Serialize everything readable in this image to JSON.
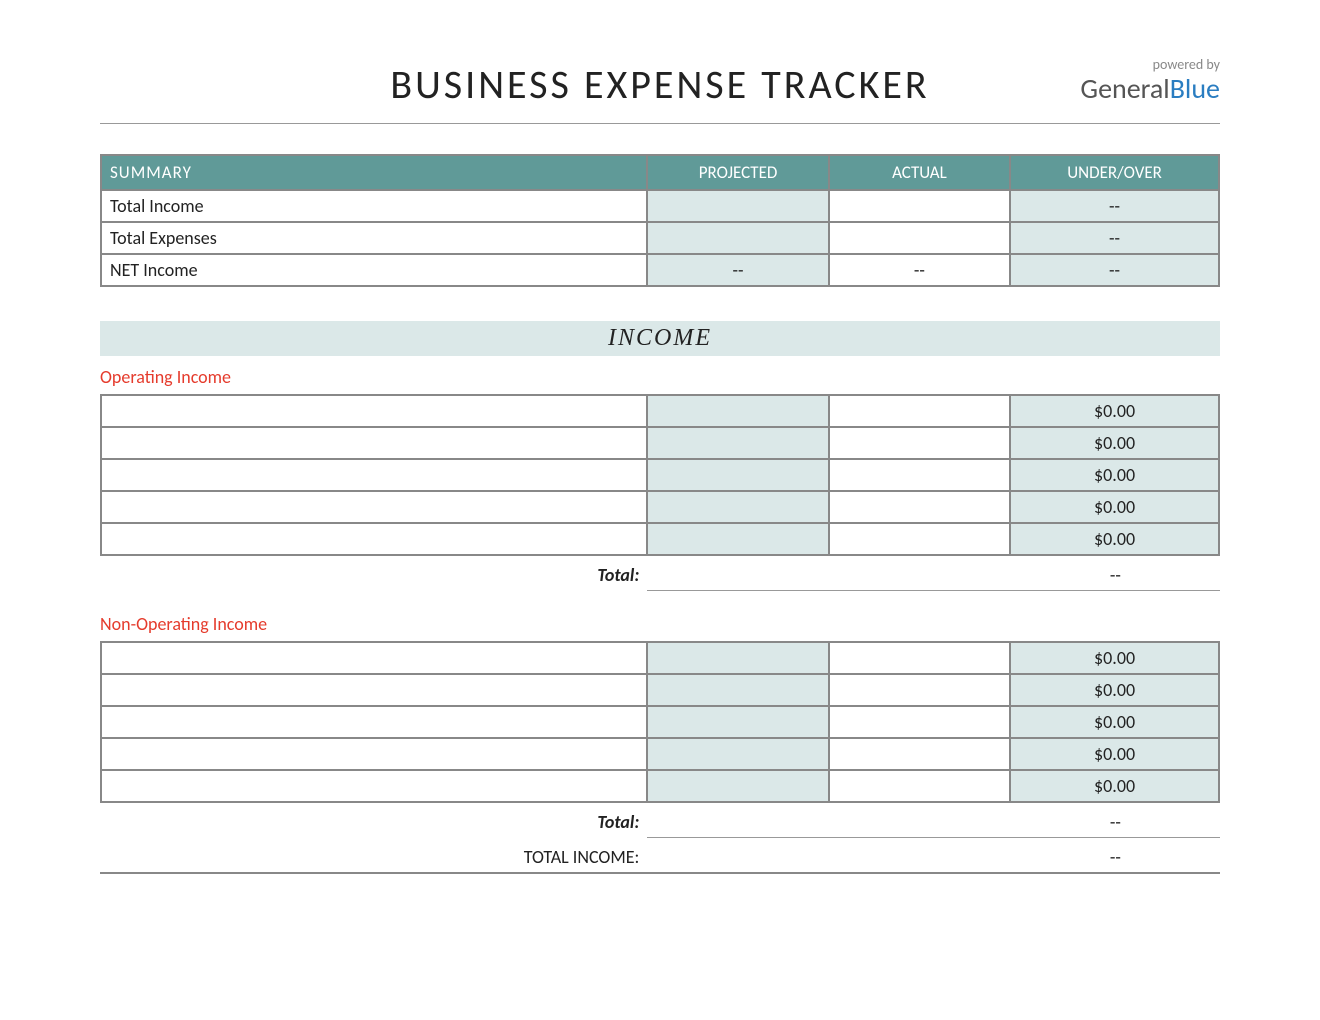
{
  "header": {
    "title": "BUSINESS EXPENSE TRACKER",
    "powered_by": "powered by",
    "brand_general": "General",
    "brand_blue": "Blue"
  },
  "summary": {
    "header_label": "SUMMARY",
    "col_projected": "PROJECTED",
    "col_actual": "ACTUAL",
    "col_underover": "UNDER/OVER",
    "rows": [
      {
        "label": "Total Income",
        "projected": "",
        "actual": "",
        "underover": "--"
      },
      {
        "label": "Total Expenses",
        "projected": "",
        "actual": "",
        "underover": "--"
      },
      {
        "label": "NET Income",
        "projected": "--",
        "actual": "--",
        "underover": "--"
      }
    ]
  },
  "income": {
    "section_title": "INCOME",
    "operating": {
      "heading": "Operating Income",
      "rows": [
        {
          "desc": "",
          "projected": "",
          "actual": "",
          "underover": "$0.00"
        },
        {
          "desc": "",
          "projected": "",
          "actual": "",
          "underover": "$0.00"
        },
        {
          "desc": "",
          "projected": "",
          "actual": "",
          "underover": "$0.00"
        },
        {
          "desc": "",
          "projected": "",
          "actual": "",
          "underover": "$0.00"
        },
        {
          "desc": "",
          "projected": "",
          "actual": "",
          "underover": "$0.00"
        }
      ],
      "total_label": "Total:",
      "total_value": "--"
    },
    "nonoperating": {
      "heading": "Non-Operating Income",
      "rows": [
        {
          "desc": "",
          "projected": "",
          "actual": "",
          "underover": "$0.00"
        },
        {
          "desc": "",
          "projected": "",
          "actual": "",
          "underover": "$0.00"
        },
        {
          "desc": "",
          "projected": "",
          "actual": "",
          "underover": "$0.00"
        },
        {
          "desc": "",
          "projected": "",
          "actual": "",
          "underover": "$0.00"
        },
        {
          "desc": "",
          "projected": "",
          "actual": "",
          "underover": "$0.00"
        }
      ],
      "total_label": "Total:",
      "total_value": "--"
    },
    "grand_label": "TOTAL INCOME:",
    "grand_value": "--"
  }
}
